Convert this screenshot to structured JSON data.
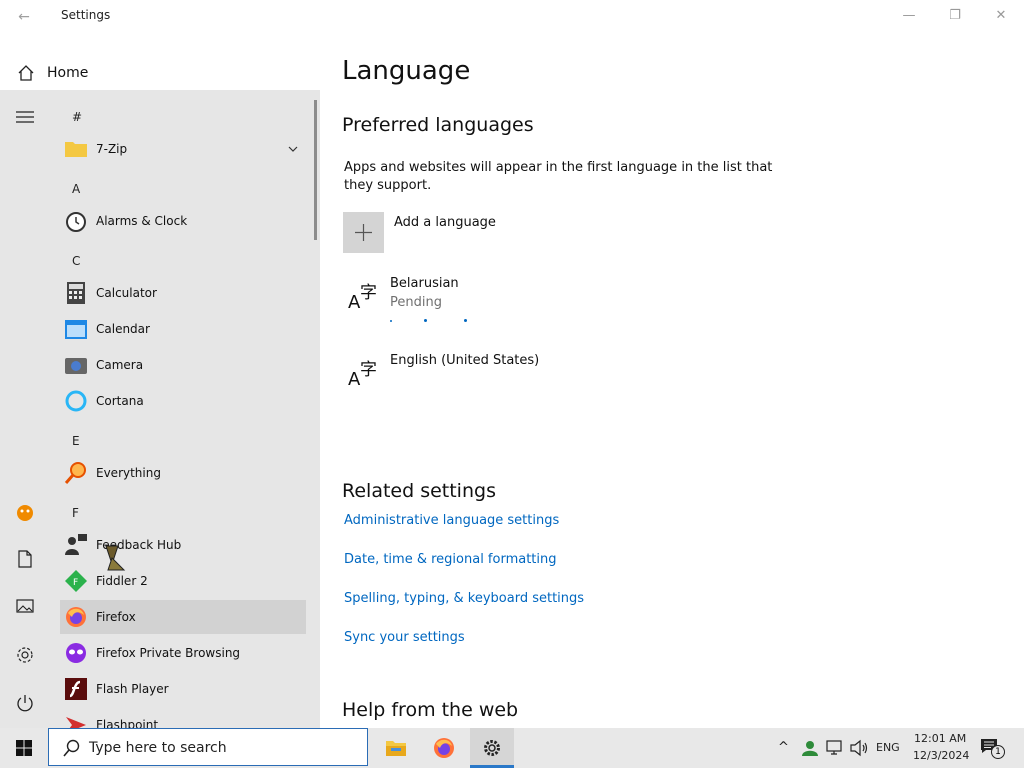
{
  "window": {
    "title": "Settings",
    "back_glyph": "←",
    "min_glyph": "—",
    "max_glyph": "❐",
    "close_glyph": "✕"
  },
  "nav": {
    "home_label": "Home"
  },
  "content": {
    "title": "Language",
    "preferred_heading": "Preferred languages",
    "preferred_desc": "Apps and websites will appear in the first language in the list that they support.",
    "add_language_label": "Add a language",
    "languages": [
      {
        "name": "Belarusian",
        "status": "Pending"
      },
      {
        "name": "English (United States)",
        "status": ""
      }
    ],
    "related_heading": "Related settings",
    "related_links": [
      "Administrative language settings",
      "Date, time & regional formatting",
      "Spelling, typing, & keyboard settings",
      "Sync your settings"
    ],
    "help_heading": "Help from the web"
  },
  "start_menu": {
    "groups": [
      {
        "letter": "#",
        "apps": [
          {
            "label": "7-Zip",
            "icon": "folder-icon"
          }
        ]
      },
      {
        "letter": "A",
        "apps": [
          {
            "label": "Alarms & Clock",
            "icon": "alarm-clock-icon"
          }
        ]
      },
      {
        "letter": "C",
        "apps": [
          {
            "label": "Calculator",
            "icon": "calculator-icon"
          },
          {
            "label": "Calendar",
            "icon": "calendar-icon"
          },
          {
            "label": "Camera",
            "icon": "camera-icon"
          },
          {
            "label": "Cortana",
            "icon": "cortana-icon"
          }
        ]
      },
      {
        "letter": "E",
        "apps": [
          {
            "label": "Everything",
            "icon": "search-magnifier-icon"
          }
        ]
      },
      {
        "letter": "F",
        "apps": [
          {
            "label": "Feedback Hub",
            "icon": "feedback-hub-icon"
          },
          {
            "label": "Fiddler 2",
            "icon": "fiddler-icon"
          },
          {
            "label": "Firefox",
            "icon": "firefox-icon"
          },
          {
            "label": "Firefox Private Browsing",
            "icon": "firefox-private-icon"
          },
          {
            "label": "Flash Player",
            "icon": "flash-player-icon"
          },
          {
            "label": "Flashpoint",
            "icon": "flashpoint-icon"
          }
        ]
      }
    ]
  },
  "taskbar": {
    "search_placeholder": "Type here to search",
    "language_indicator": "ENG",
    "time": "12:01 AM",
    "date": "12/3/2024",
    "notification_count": "1",
    "tray_chevron": "^"
  }
}
